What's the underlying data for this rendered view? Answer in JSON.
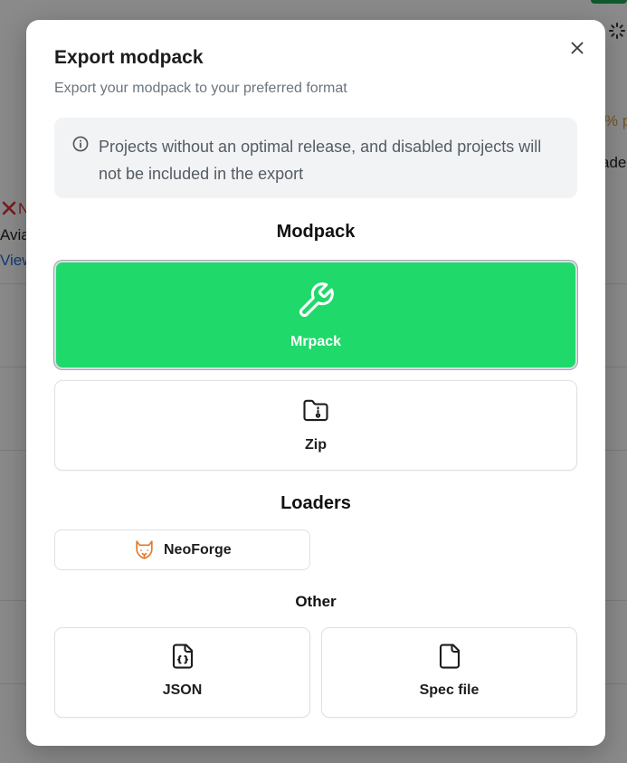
{
  "background": {
    "fragments": [
      "% p",
      "ade",
      "Avia",
      "View",
      "N"
    ]
  },
  "dialog": {
    "title": "Export modpack",
    "subtitle": "Export your modpack to your preferred format",
    "notice": "Projects without an optimal release, and disabled projects will not be included in the export",
    "sections": {
      "modpack": "Modpack",
      "loaders": "Loaders",
      "other": "Other"
    },
    "modpack_options": [
      {
        "label": "Mrpack",
        "icon": "wrench-icon",
        "selected": true
      },
      {
        "label": "Zip",
        "icon": "folder-zip-icon",
        "selected": false
      }
    ],
    "loaders": [
      {
        "label": "NeoForge",
        "icon": "neoforge-fox-icon"
      }
    ],
    "other_options": [
      {
        "label": "JSON",
        "icon": "file-json-icon"
      },
      {
        "label": "Spec file",
        "icon": "file-icon"
      }
    ]
  },
  "colors": {
    "accent": "#1fd96a",
    "neoforge": "#e2792b",
    "error": "#e03131",
    "link": "#1c6bd6",
    "warning": "#d9a13b"
  }
}
